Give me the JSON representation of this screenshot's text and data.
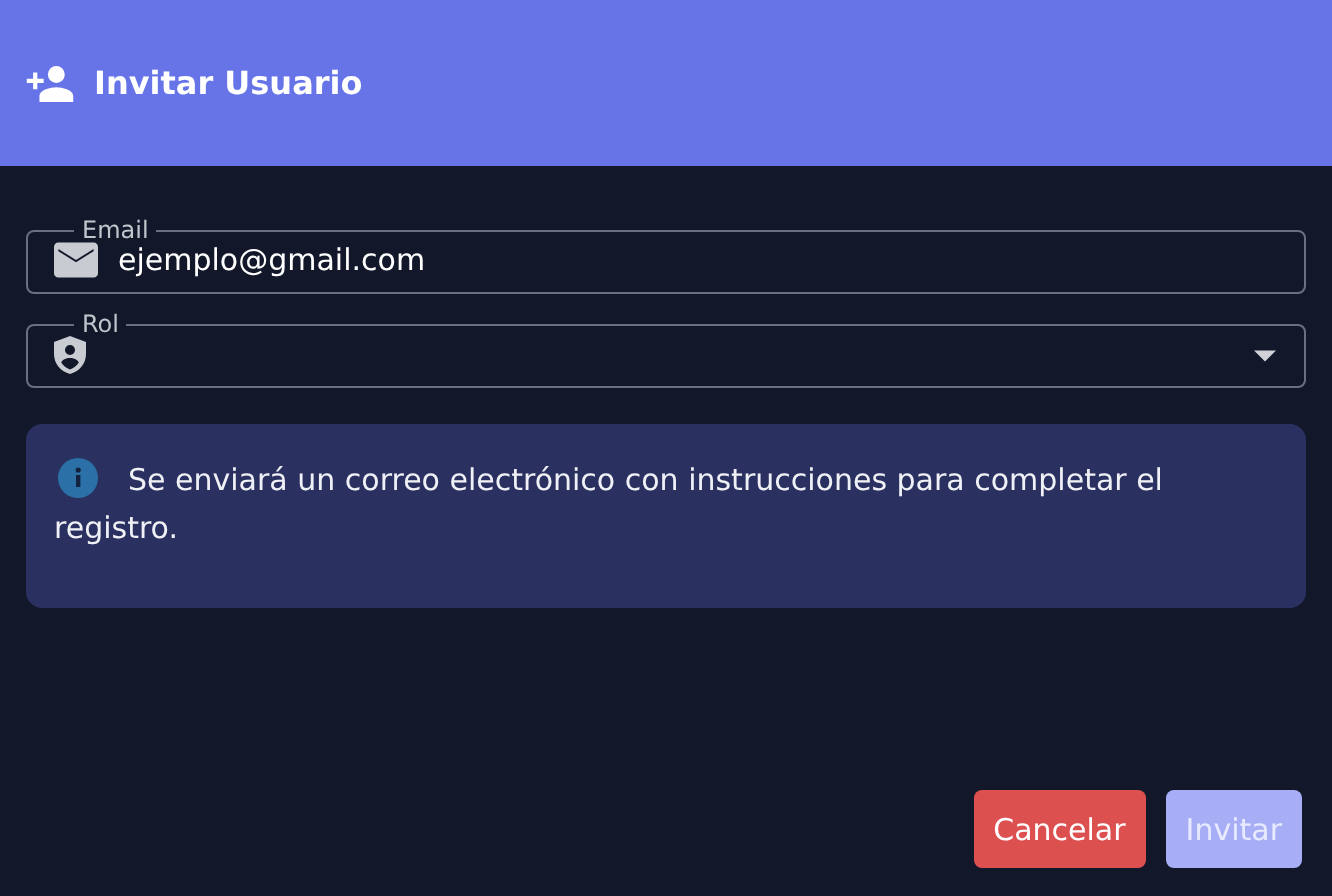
{
  "dialog": {
    "title": "Invitar Usuario"
  },
  "fields": [
    {
      "kind": "text",
      "label": "Email",
      "value": "ejemplo@gmail.com"
    },
    {
      "kind": "select",
      "label": "Rol"
    }
  ],
  "info": {
    "message": "Se enviará un correo electrónico con instrucciones para completar el registro."
  },
  "buttons": [
    {
      "label": "Cancelar",
      "kind": "danger",
      "disabled": false
    },
    {
      "label": "Invitar",
      "kind": "primary",
      "disabled": true
    }
  ]
}
